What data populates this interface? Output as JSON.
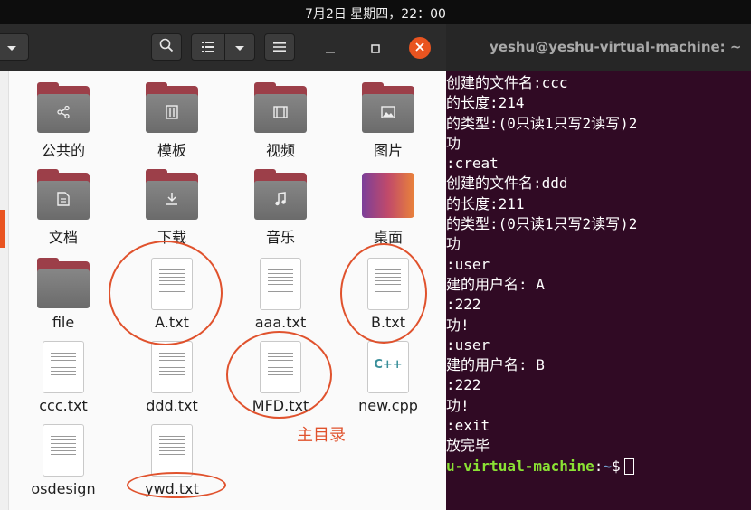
{
  "topbar": {
    "clock": "7月2日 星期四，22：00"
  },
  "file_manager": {
    "items": [
      {
        "label": "公共的",
        "kind": "folder",
        "emblem": "share-icon"
      },
      {
        "label": "模板",
        "kind": "folder",
        "emblem": "template-icon"
      },
      {
        "label": "视频",
        "kind": "folder",
        "emblem": "video-icon"
      },
      {
        "label": "图片",
        "kind": "folder",
        "emblem": "picture-icon"
      },
      {
        "label": "文档",
        "kind": "folder",
        "emblem": "document-icon"
      },
      {
        "label": "下载",
        "kind": "folder",
        "emblem": "download-icon"
      },
      {
        "label": "音乐",
        "kind": "folder",
        "emblem": "music-icon"
      },
      {
        "label": "桌面",
        "kind": "desktop-folder"
      },
      {
        "label": "file",
        "kind": "folder"
      },
      {
        "label": "A.txt",
        "kind": "text"
      },
      {
        "label": "aaa.txt",
        "kind": "text"
      },
      {
        "label": "B.txt",
        "kind": "text"
      },
      {
        "label": "ccc.txt",
        "kind": "text"
      },
      {
        "label": "ddd.txt",
        "kind": "text"
      },
      {
        "label": "MFD.txt",
        "kind": "text"
      },
      {
        "label": "new.cpp",
        "kind": "cpp",
        "badge": "C++"
      },
      {
        "label": "osdesign",
        "kind": "text"
      },
      {
        "label": "ywd.txt",
        "kind": "text"
      }
    ],
    "annotation_label": "主目录",
    "annotation_color": "#e0522d"
  },
  "terminal": {
    "title": "yeshu@yeshu-virtual-machine: ~",
    "lines": [
      "创建的文件名:ccc",
      "的长度:214",
      "的类型:(0只读1只写2读写)2",
      "功",
      ":creat",
      "创建的文件名:ddd",
      "的长度:211",
      "的类型:(0只读1只写2读写)2",
      "功",
      ":user",
      "建的用户名: A",
      ":222",
      "功!",
      ":user",
      "建的用户名: B",
      ":222",
      "功!",
      ":exit",
      "放完毕"
    ],
    "prompt": {
      "host": "u-virtual-machine",
      "path": "~",
      "symbol": "$"
    }
  },
  "colors": {
    "accent": "#e95420",
    "terminal_bg": "#300a24",
    "prompt_host": "#8ae234",
    "prompt_path": "#729fcf"
  }
}
